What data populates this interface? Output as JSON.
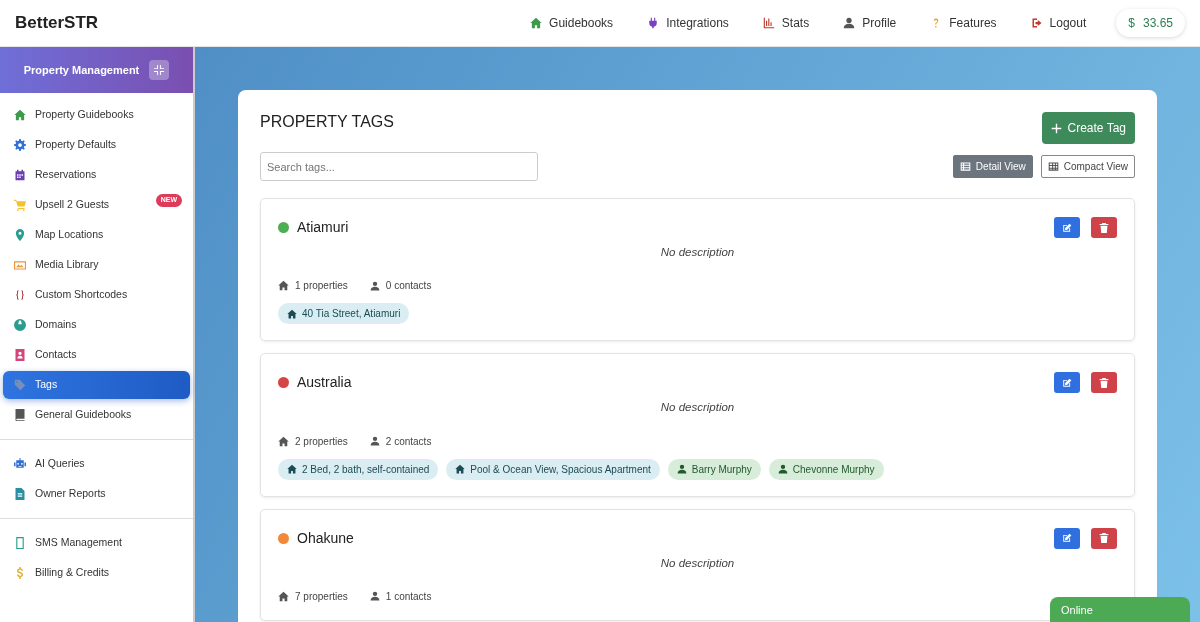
{
  "brand": "BetterSTR",
  "nav": [
    {
      "label": "Guidebooks"
    },
    {
      "label": "Integrations"
    },
    {
      "label": "Stats"
    },
    {
      "label": "Profile"
    },
    {
      "label": "Features"
    },
    {
      "label": "Logout"
    }
  ],
  "balance": {
    "symbol": "$",
    "amount": "33.65"
  },
  "sidebar": {
    "title": "Property Management",
    "sections": [
      [
        {
          "label": "Property Guidebooks",
          "selected": false
        },
        {
          "label": "Property Defaults",
          "selected": false
        },
        {
          "label": "Reservations",
          "selected": false
        },
        {
          "label": "Upsell 2 Guests",
          "selected": false,
          "badge": "NEW"
        },
        {
          "label": "Map Locations",
          "selected": false
        },
        {
          "label": "Media Library",
          "selected": false
        },
        {
          "label": "Custom Shortcodes",
          "selected": false
        },
        {
          "label": "Domains",
          "selected": false
        },
        {
          "label": "Contacts",
          "selected": false
        },
        {
          "label": "Tags",
          "selected": true
        },
        {
          "label": "General Guidebooks",
          "selected": false
        }
      ],
      [
        {
          "label": "AI Queries",
          "selected": false
        },
        {
          "label": "Owner Reports",
          "selected": false
        }
      ],
      [
        {
          "label": "SMS Management",
          "selected": false
        },
        {
          "label": "Billing & Credits",
          "selected": false
        }
      ]
    ]
  },
  "page": {
    "title": "PROPERTY TAGS",
    "create_button": "Create Tag",
    "search": {
      "placeholder": "Search tags..."
    },
    "views": [
      {
        "label": "Detail View",
        "selected": true
      },
      {
        "label": "Compact View",
        "selected": false
      }
    ]
  },
  "tags": [
    {
      "name": "Atiamuri",
      "color": "#4caf50",
      "description": "No description",
      "properties": "1 properties",
      "contacts": "0 contacts",
      "chips": [
        {
          "kind": "property",
          "label": "40 Tia Street, Atiamuri"
        }
      ]
    },
    {
      "name": "Australia",
      "color": "#d64545",
      "description": "No description",
      "properties": "2 properties",
      "contacts": "2 contacts",
      "chips": [
        {
          "kind": "property",
          "label": "2 Bed, 2 bath, self-contained"
        },
        {
          "kind": "property",
          "label": "Pool & Ocean View, Spacious Apartment"
        },
        {
          "kind": "contact",
          "label": "Barry Murphy"
        },
        {
          "kind": "contact",
          "label": "Chevonne Murphy"
        }
      ]
    },
    {
      "name": "Ohakune",
      "color": "#f08a3a",
      "description": "No description",
      "properties": "7 properties",
      "contacts": "1 contacts"
    }
  ],
  "status": {
    "label": "Online"
  }
}
